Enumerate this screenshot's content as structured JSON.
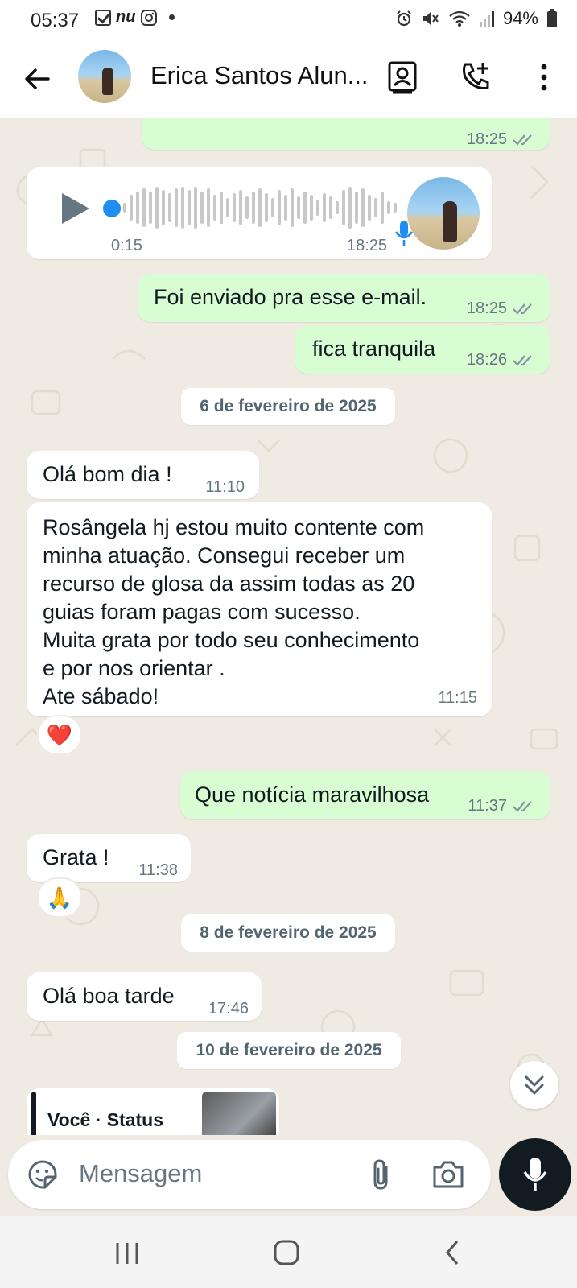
{
  "status_bar": {
    "time": "05:37",
    "notif_icons": [
      "checkbox-icon",
      "nu-icon",
      "instagram-icon",
      "dot-icon"
    ],
    "nu_text": "nu",
    "battery": "94%"
  },
  "header": {
    "contact_name": "Erica Santos Alun..."
  },
  "messages": [
    {
      "time": "18:25",
      "direction": "out"
    },
    {
      "type": "voice",
      "duration": "0:15",
      "time": "18:25"
    },
    {
      "text": "Foi enviado pra esse e-mail.",
      "time": "18:25"
    },
    {
      "text": "fica tranquila",
      "time": "18:26"
    },
    {
      "text": "Olá bom dia !",
      "time": "11:10"
    },
    {
      "text": "Rosângela hj estou muito contente com\nminha atuação. Consegui receber um\nrecurso de glosa da assim todas as 20\nguias foram pagas com sucesso.\nMuita grata por todo seu conhecimento\ne por nos orientar .\nAte sábado!",
      "time": "11:15",
      "reaction": "❤️"
    },
    {
      "text": "Que notícia maravilhosa",
      "time": "11:37"
    },
    {
      "text": "Grata !",
      "time": "11:38",
      "reaction": "🙏"
    },
    {
      "text": "Olá boa tarde",
      "time": "17:46"
    }
  ],
  "dates": {
    "d1": "6 de fevereiro de 2025",
    "d2": "8 de fevereiro de 2025",
    "d3": "10 de fevereiro de 2025"
  },
  "partial_message": {
    "text": "Você · Status"
  },
  "input": {
    "placeholder": "Mensagem"
  },
  "colors": {
    "outgoing_bubble": "#d9fdd3",
    "incoming_bubble": "#ffffff",
    "chat_bg": "#efeae2",
    "mic_button": "#111b21",
    "voice_accent": "#1f8ef1"
  }
}
